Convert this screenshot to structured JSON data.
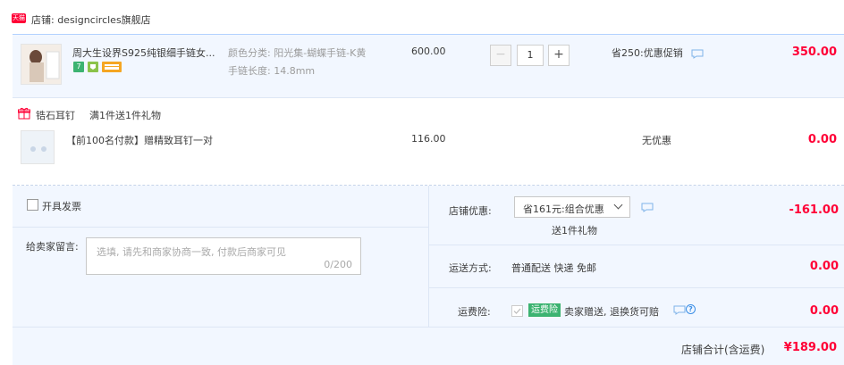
{
  "store": {
    "badge": "天猫",
    "name": "店铺: designcircles旗舰店"
  },
  "item1": {
    "title": "周大生设界S925纯银细手链女...",
    "badges": [
      "7",
      "",
      ""
    ],
    "sku_color": "颜色分类: 阳光集-蝴蝶手链-K黄",
    "sku_length": "手链长度: 14.8mm",
    "price": "600.00",
    "quantity": "1",
    "promo": "省250:优惠促销",
    "amount": "350.00"
  },
  "gift": {
    "name": "锆石耳钉",
    "rule": "满1件送1件礼物"
  },
  "item2": {
    "title": "【前100名付款】赠精致耳钉一对",
    "price": "116.00",
    "promo": "无优惠",
    "amount": "0.00"
  },
  "invoice": {
    "label": "开具发票"
  },
  "message": {
    "label": "给卖家留言:",
    "placeholder": "选填, 请先和商家协商一致, 付款后商家可见",
    "count": "0/200"
  },
  "discount": {
    "label": "店铺优惠:",
    "selected": "省161元:组合优惠",
    "sub": "送1件礼物",
    "amount": "-161.00"
  },
  "shipping": {
    "label": "运送方式:",
    "value": "普通配送 快递 免邮",
    "amount": "0.00"
  },
  "insurance": {
    "label": "运费险:",
    "badge": "运费险",
    "text": "卖家赠送, 退换货可赔",
    "amount": "0.00"
  },
  "total": {
    "label": "店铺合计(含运费)",
    "amount": "¥189.00"
  },
  "colors": {
    "accent_red": "#ff0036",
    "row_blue": "#f2f7ff",
    "insurance_green": "#3cb371"
  }
}
